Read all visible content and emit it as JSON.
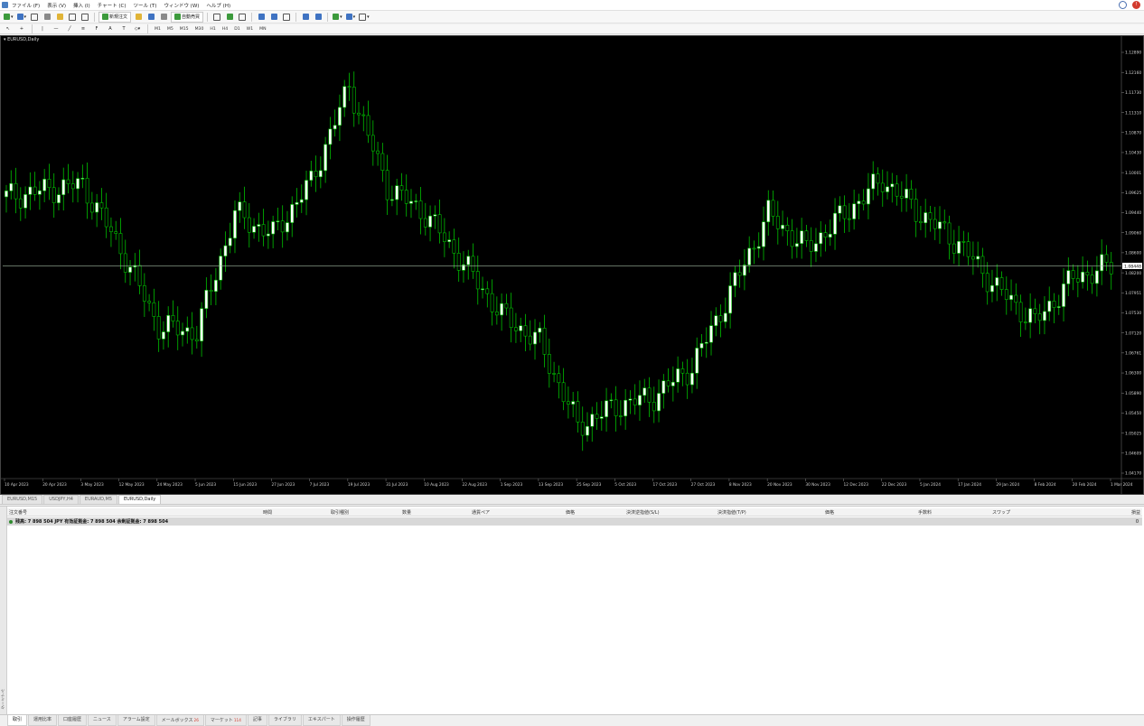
{
  "menu": [
    "ファイル (F)",
    "表示 (V)",
    "挿入 (I)",
    "チャート (C)",
    "ツール (T)",
    "ウィンドウ (W)",
    "ヘルプ (H)"
  ],
  "toolbar": {
    "new_order": "新規注文",
    "auto_trading": "自動売買",
    "timeframes": [
      "M1",
      "M5",
      "M15",
      "M30",
      "H1",
      "H4",
      "D1",
      "W1",
      "MN"
    ]
  },
  "chart": {
    "title": "EURUSD,Daily",
    "current_price": "1.08448",
    "price_labels": [
      "1.12890",
      "1.12160",
      "1.11730",
      "1.11310",
      "1.10870",
      "1.10430",
      "1.10001",
      "1.09625",
      "1.09440",
      "1.09060",
      "1.08600",
      "1.08200",
      "1.07951",
      "1.07530",
      "1.07120",
      "1.06761",
      "1.06300",
      "1.05890",
      "1.05450",
      "1.05025",
      "1.04609",
      "1.04170"
    ],
    "date_labels": [
      "10 Apr 2023",
      "20 Apr 2023",
      "3 May 2023",
      "12 May 2023",
      "24 May 2023",
      "5 Jun 2023",
      "15 Jun 2023",
      "27 Jun 2023",
      "7 Jul 2023",
      "19 Jul 2023",
      "31 Jul 2023",
      "10 Aug 2023",
      "22 Aug 2023",
      "1 Sep 2023",
      "13 Sep 2023",
      "25 Sep 2023",
      "5 Oct 2023",
      "17 Oct 2023",
      "27 Oct 2023",
      "8 Nov 2023",
      "20 Nov 2023",
      "30 Nov 2023",
      "12 Dec 2023",
      "22 Dec 2023",
      "5 Jan 2024",
      "17 Jan 2024",
      "29 Jan 2024",
      "8 Feb 2024",
      "20 Feb 2024",
      "1 Mar 2024"
    ],
    "colors": {
      "background": "#000000",
      "bull_candle": "#ffffff",
      "bear_candle": "#000000",
      "wick": "#00c000",
      "grid_line": "#9fb89f"
    }
  },
  "chart_data": {
    "type": "candlestick",
    "symbol": "EURUSD",
    "timeframe": "Daily",
    "ylim": [
      1.0417,
      1.1289
    ],
    "x": [
      "10 Apr 2023",
      "20 Apr 2023",
      "3 May 2023",
      "12 May 2023",
      "24 May 2023",
      "5 Jun 2023",
      "15 Jun 2023",
      "27 Jun 2023",
      "7 Jul 2023",
      "19 Jul 2023",
      "31 Jul 2023",
      "10 Aug 2023",
      "22 Aug 2023",
      "1 Sep 2023",
      "13 Sep 2023",
      "25 Sep 2023",
      "5 Oct 2023",
      "17 Oct 2023",
      "27 Oct 2023",
      "8 Nov 2023",
      "20 Nov 2023",
      "30 Nov 2023",
      "12 Dec 2023",
      "22 Dec 2023",
      "5 Jan 2024",
      "17 Jan 2024",
      "29 Jan 2024",
      "8 Feb 2024",
      "20 Feb 2024",
      "1 Mar 2024"
    ],
    "close": [
      1.0985,
      1.0998,
      1.101,
      1.088,
      1.0722,
      1.071,
      1.095,
      1.0908,
      1.1015,
      1.121,
      1.1005,
      1.095,
      1.085,
      1.0745,
      1.069,
      1.052,
      1.056,
      1.058,
      1.064,
      1.079,
      1.095,
      1.088,
      1.095,
      1.102,
      1.095,
      1.089,
      1.08,
      1.073,
      1.082,
      1.0845
    ],
    "current_price": 1.08448
  },
  "tabs": [
    "EURUSD,M15",
    "USDJPY,H4",
    "EURAUD,M5",
    "EURUSD,Daily"
  ],
  "active_tab": "EURUSD,Daily",
  "terminal": {
    "columns": [
      "注文番号",
      "時間",
      "取引種別",
      "数量",
      "通貨ペア",
      "価格",
      "決済逆指値(S/L)",
      "決済指値(T/P)",
      "価格",
      "手数料",
      "スワップ",
      "損益"
    ],
    "balance_text": "残高: 7 898 504 JPY 有効証拠金: 7 898 504 余剰証拠金: 7 898 504",
    "balance_value": "0",
    "side_label": "ターミナル"
  },
  "bottom_tabs": [
    {
      "label": "取引",
      "badge": ""
    },
    {
      "label": "運用比率",
      "badge": ""
    },
    {
      "label": "口座履歴",
      "badge": ""
    },
    {
      "label": "ニュース",
      "badge": ""
    },
    {
      "label": "アラーム設定",
      "badge": ""
    },
    {
      "label": "メールボックス",
      "badge": "26"
    },
    {
      "label": "マーケット",
      "badge": "114"
    },
    {
      "label": "記事",
      "badge": ""
    },
    {
      "label": "ライブラリ",
      "badge": ""
    },
    {
      "label": "エキスパート",
      "badge": ""
    },
    {
      "label": "操作履歴",
      "badge": ""
    }
  ]
}
